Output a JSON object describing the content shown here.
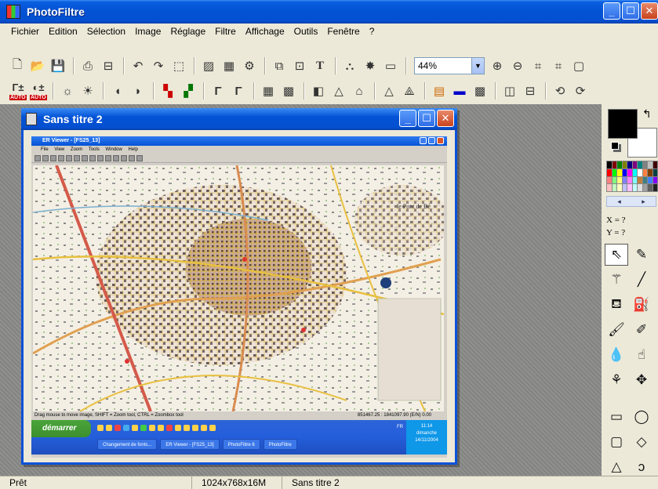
{
  "app": {
    "title": "PhotoFiltre"
  },
  "menu": [
    "Fichier",
    "Edition",
    "Sélection",
    "Image",
    "Réglage",
    "Filtre",
    "Affichage",
    "Outils",
    "Fenêtre",
    "?"
  ],
  "toolbar": {
    "zoom_value": "44%",
    "auto_label": "AUTO"
  },
  "child_window": {
    "title": "Sans titre 2"
  },
  "nested": {
    "title": "ER Viewer - [FS25_13]",
    "menu": [
      "File",
      "View",
      "Zoom",
      "Tools",
      "Window",
      "Help"
    ],
    "status_left": "Drag mouse to move image, SHIFT = Zoom tool, CTRL = Zoombox tool",
    "status_right": "851467.25 : 1841097.90 (E/N)      0.00",
    "start": "démarrer",
    "lang": "FR",
    "clock_time": "11:14",
    "clock_day": "dimanche",
    "clock_date": "14/11/2004",
    "tasks": [
      "Changement de fonts...",
      "ER Viewer - [FS25_13]",
      "PhotoFiltre 6",
      "PhotoFiltre"
    ],
    "map_labels": [
      "le Pont de Bé"
    ]
  },
  "palette": {
    "x_label": "X = ?",
    "y_label": "Y = ?",
    "prev": "◂",
    "next": "▸"
  },
  "status": {
    "ready": "Prêt",
    "dims": "1024x768x16M",
    "doc": "Sans titre 2"
  }
}
